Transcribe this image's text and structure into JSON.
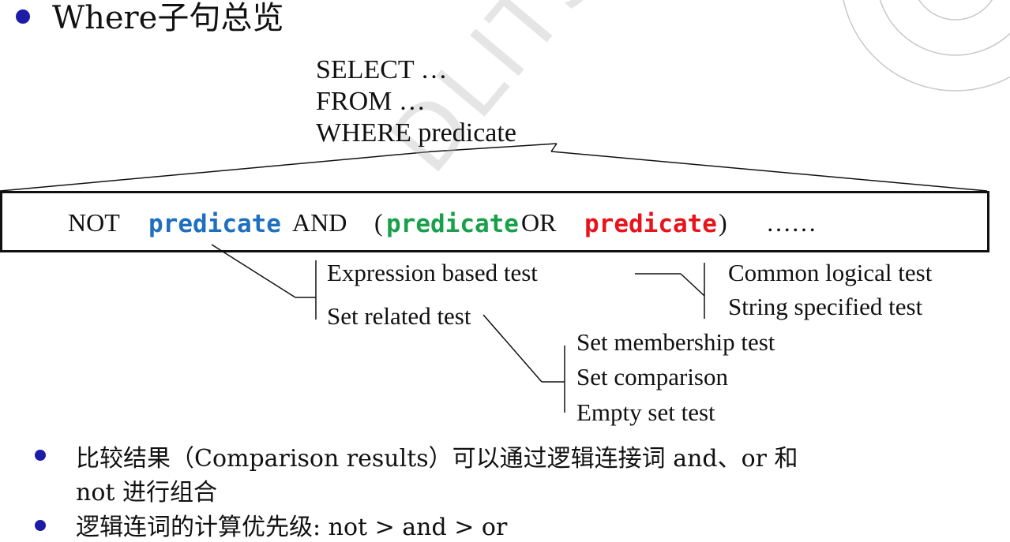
{
  "title": "Where子句总览",
  "sql": {
    "line1": "SELECT …",
    "line2": "FROM …",
    "line3": "WHERE predicate"
  },
  "box": {
    "not": "NOT",
    "pred1": "predicate",
    "and": "AND",
    "open_paren": "(",
    "pred2": "predicate",
    "or": "OR",
    "pred3": "predicate",
    "close_paren": ")",
    "ellipsis": "……"
  },
  "colors": {
    "pred1": "#1f6fbf",
    "pred2": "#1aa04a",
    "pred3": "#e8141c",
    "bullet": "#1c1ca6"
  },
  "tree": {
    "expression_test": "Expression based test",
    "set_related_test": "Set related test",
    "common_logical_test": "Common logical test",
    "string_specified_test": "String specified test",
    "set_membership_test": "Set membership test",
    "set_comparison": "Set comparison",
    "empty_set_test": "Empty set test"
  },
  "notes": {
    "note1_line1": "比较结果（Comparison results）可以通过逻辑连接词 and、or 和",
    "note1_line2": "not 进行组合",
    "note2": "逻辑连词的计算优先级: not > and > or"
  },
  "watermark": "DLITSS"
}
